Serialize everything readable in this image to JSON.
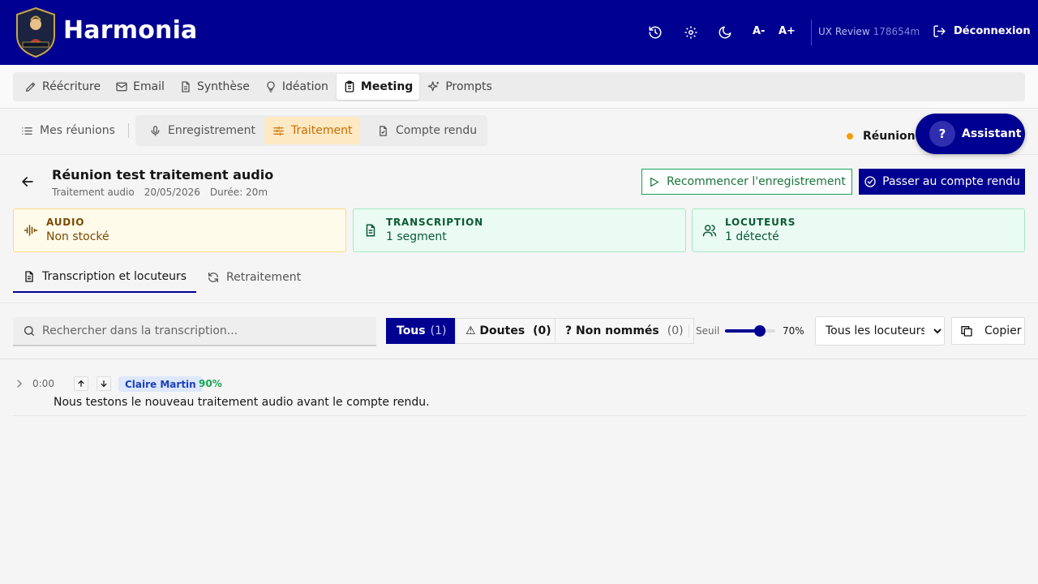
{
  "app": {
    "title": "Harmonia"
  },
  "header": {
    "font_decrease": "A-",
    "font_increase": "A+",
    "user_name": "UX Review",
    "user_id": "178654m",
    "logout_label": "Déconnexion"
  },
  "main_tabs": [
    {
      "label": "Réécriture",
      "icon": "pen-icon"
    },
    {
      "label": "Email",
      "icon": "mail-icon"
    },
    {
      "label": "Synthèse",
      "icon": "document-icon"
    },
    {
      "label": "Idéation",
      "icon": "lightbulb-icon"
    },
    {
      "label": "Meeting",
      "icon": "clipboard-icon",
      "active": true
    },
    {
      "label": "Prompts",
      "icon": "sparkles-icon"
    }
  ],
  "sub_nav": {
    "my_meetings": "Mes réunions",
    "recording": "Enregistrement",
    "processing": "Traitement",
    "report": "Compte rendu",
    "status_text": "Réunion t",
    "status_color": "#f59e0b"
  },
  "assistant": {
    "label": "Assistant",
    "badge": "?"
  },
  "meeting": {
    "title": "Réunion test traitement audio",
    "type": "Traitement audio",
    "date": "20/05/2026",
    "duration": "Durée: 20m",
    "restart_label": "Recommencer l'enregistrement",
    "next_label": "Passer au compte rendu"
  },
  "cards": {
    "audio": {
      "label": "Audio",
      "value": "Non stocké"
    },
    "transcription": {
      "label": "Transcription",
      "value": "1 segment"
    },
    "speakers": {
      "label": "Locuteurs",
      "value": "1 détecté"
    }
  },
  "inner_tabs": {
    "transcription": "Transcription et locuteurs",
    "reprocessing": "Retraitement"
  },
  "toolbar": {
    "search_placeholder": "Rechercher dans la transcription...",
    "filter_all": "Tous",
    "filter_all_count": "(1)",
    "filter_doubts": "⚠ Doutes",
    "filter_doubts_count": "(0)",
    "filter_unnamed": "? Non nommés",
    "filter_unnamed_count": "(0)",
    "threshold_label": "Seuil",
    "threshold_value": 0.7,
    "threshold_text": "70%",
    "speaker_select": "Tous les locuteurs",
    "copy_label": "Copier"
  },
  "segments": [
    {
      "time": "0:00",
      "speaker": "Claire Martin",
      "confidence": "90%",
      "text": "Nous testons le nouveau traitement audio avant le compte rendu."
    }
  ],
  "colors": {
    "primary": "#000091",
    "processing_accent": "#c86d00",
    "success": "#18753c"
  }
}
